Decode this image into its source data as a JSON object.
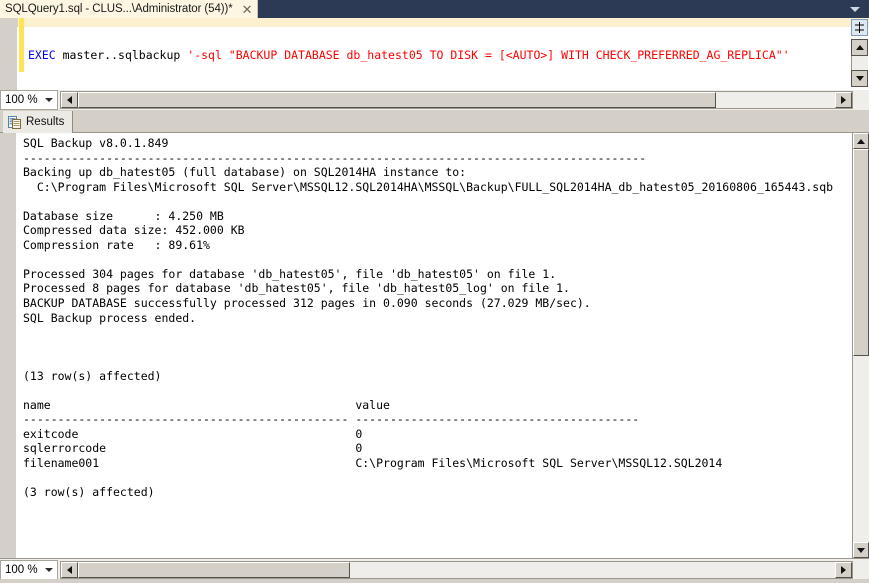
{
  "window": {
    "tab": {
      "title": "SQLQuery1.sql - CLUS...\\Administrator (54))*",
      "close_icon": "close-icon",
      "overflow_icon": "chevron-down-icon"
    }
  },
  "editor": {
    "zoom": "100 %",
    "code": {
      "exec_keyword": "EXEC",
      "proc": " master..sqlbackup ",
      "arg_quote_open": "'-sql \"",
      "backup_stmt": "BACKUP DATABASE db_hatest05 TO DISK = [<AUTO>] WITH CHECK_PREFERRED_AG_REPLICA",
      "arg_quote_close": "\"'"
    },
    "full_line": "EXEC master..sqlbackup '-sql \"BACKUP DATABASE db_hatest05 TO DISK = [<AUTO>] WITH CHECK_PREFERRED_AG_REPLICA\"'",
    "split_icon": "split-pane-icon",
    "scroll_left_icon": "triangle-left-icon",
    "scroll_right_icon": "triangle-right-icon"
  },
  "results": {
    "tab_label": "Results",
    "tab_icon": "results-grid-icon",
    "zoom": "100 %",
    "scroll_up_icon": "triangle-up-icon",
    "scroll_down_icon": "triangle-down-icon",
    "output": "SQL Backup v8.0.1.849\n------------------------------------------------------------------------------------------\nBacking up db_hatest05 (full database) on SQL2014HA instance to:\n  C:\\Program Files\\Microsoft SQL Server\\MSSQL12.SQL2014HA\\MSSQL\\Backup\\FULL_SQL2014HA_db_hatest05_20160806_165443.sqb\n\nDatabase size      : 4.250 MB\nCompressed data size: 452.000 KB\nCompression rate   : 89.61%\n\nProcessed 304 pages for database 'db_hatest05', file 'db_hatest05' on file 1.\nProcessed 8 pages for database 'db_hatest05', file 'db_hatest05_log' on file 1.\nBACKUP DATABASE successfully processed 312 pages in 0.090 seconds (27.029 MB/sec).\nSQL Backup process ended.\n\n\n\n(13 row(s) affected)\n\nname                                            value\n----------------------------------------------- -----------------------------------------\nexitcode                                        0\nsqlerrorcode                                    0\nfilename001                                     C:\\Program Files\\Microsoft SQL Server\\MSSQL12.SQL2014\n\n(3 row(s) affected)",
    "details": {
      "version_line": "SQL Backup v8.0.1.849",
      "backing_up_line": "Backing up db_hatest05 (full database) on SQL2014HA instance to:",
      "backup_path": "C:\\Program Files\\Microsoft SQL Server\\MSSQL12.SQL2014HA\\MSSQL\\Backup\\FULL_SQL2014HA_db_hatest05_20160806_165443.sqb",
      "database_size_label": "Database size",
      "database_size_value": "4.250 MB",
      "compressed_size_label": "Compressed data size",
      "compressed_size_value": "452.000 KB",
      "compression_rate_label": "Compression rate",
      "compression_rate_value": "89.61%",
      "processed_data_line": "Processed 304 pages for database 'db_hatest05', file 'db_hatest05' on file 1.",
      "processed_log_line": "Processed 8 pages for database 'db_hatest05', file 'db_hatest05_log' on file 1.",
      "backup_summary_line": "BACKUP DATABASE successfully processed 312 pages in 0.090 seconds (27.029 MB/sec).",
      "process_ended_line": "SQL Backup process ended.",
      "rows_affected_13": "(13 row(s) affected)",
      "rows_affected_3": "(3 row(s) affected)",
      "columns": [
        "name",
        "value"
      ],
      "rows": [
        {
          "name": "exitcode",
          "value": "0"
        },
        {
          "name": "sqlerrorcode",
          "value": "0"
        },
        {
          "name": "filename001",
          "value": "C:\\Program Files\\Microsoft SQL Server\\MSSQL12.SQL2014"
        }
      ]
    }
  },
  "colors": {
    "tab_active_bg": "#fdf6e3",
    "tabstrip_bg": "#2d3a56",
    "keyword": "#0000ff",
    "string": "#ff0000",
    "change_bar": "#ffe357",
    "chrome": "#d4d0c8"
  }
}
